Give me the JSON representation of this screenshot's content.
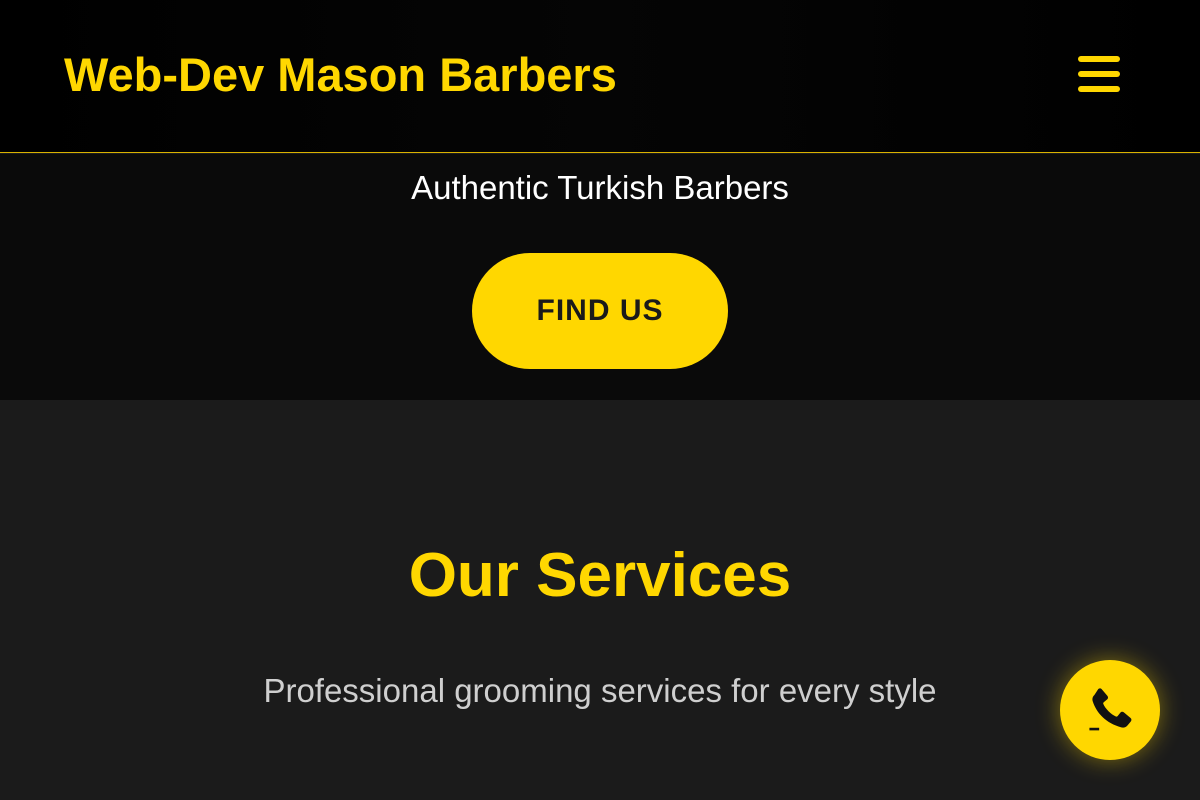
{
  "header": {
    "brand": "Web-Dev Mason Barbers",
    "menu_icon": "hamburger-menu-icon"
  },
  "hero": {
    "tagline": "Authentic Turkish Barbers",
    "cta_label": "FIND US"
  },
  "services": {
    "title": "Our Services",
    "subtitle": "Professional grooming services for every style"
  },
  "floating": {
    "call_icon": "phone-icon"
  },
  "colors": {
    "accent": "#ffd700",
    "header_bg": "#000000",
    "hero_bg": "#0a0a0a",
    "section_bg": "#1b1b1b"
  }
}
